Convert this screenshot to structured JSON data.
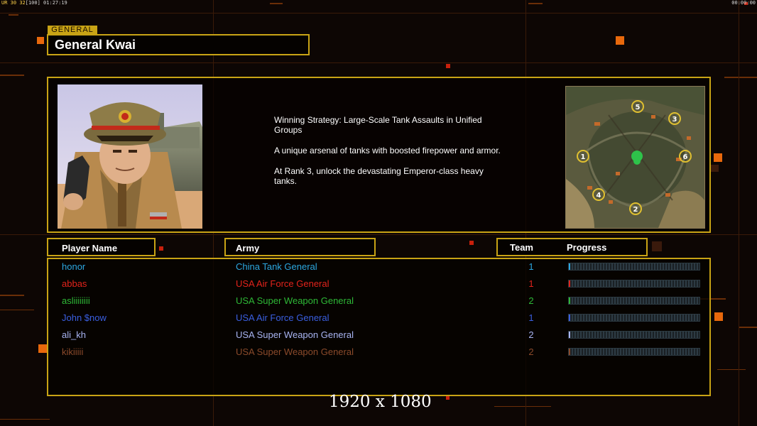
{
  "hud": {
    "left_prefix": "UR",
    "left_a": "30",
    "left_b": "32",
    "left_c": "[100]",
    "left_time": "01:27:19",
    "right_time": "00:00:00"
  },
  "general": {
    "tag": "GENERAL",
    "name": "General Kwai"
  },
  "description": {
    "line1": "Winning Strategy: Large-Scale Tank Assaults in Unified Groups",
    "line2": "A unique arsenal of tanks with boosted firepower and armor.",
    "line3": "At Rank 3, unlock the devastating Emperor-class heavy tanks."
  },
  "minimap": {
    "slots": [
      "1",
      "2",
      "3",
      "4",
      "5",
      "6"
    ]
  },
  "headers": {
    "player": "Player Name",
    "army": "Army",
    "team": "Team",
    "progress": "Progress"
  },
  "players": [
    {
      "name": "honor",
      "army": "China Tank General",
      "team": "1",
      "color": "#2ca7e0",
      "progress": 0.01
    },
    {
      "name": "abbas",
      "army": "USA Air Force General",
      "team": "1",
      "color": "#e2231b",
      "progress": 0.01
    },
    {
      "name": "asliiiiiiii",
      "army": "USA Super Weapon General",
      "team": "2",
      "color": "#2eb836",
      "progress": 0.01
    },
    {
      "name": "John $now",
      "army": "USA Air Force General",
      "team": "1",
      "color": "#3a5fe0",
      "progress": 0.01
    },
    {
      "name": "ali_kh",
      "army": "USA Super Weapon General",
      "team": "2",
      "color": "#a8b4f2",
      "progress": 0.01
    },
    {
      "name": "kikiiiii",
      "army": "USA Super Weapon General",
      "team": "2",
      "color": "#8a4a2a",
      "progress": 0.01
    }
  ],
  "watermark": "1920 x 1080"
}
